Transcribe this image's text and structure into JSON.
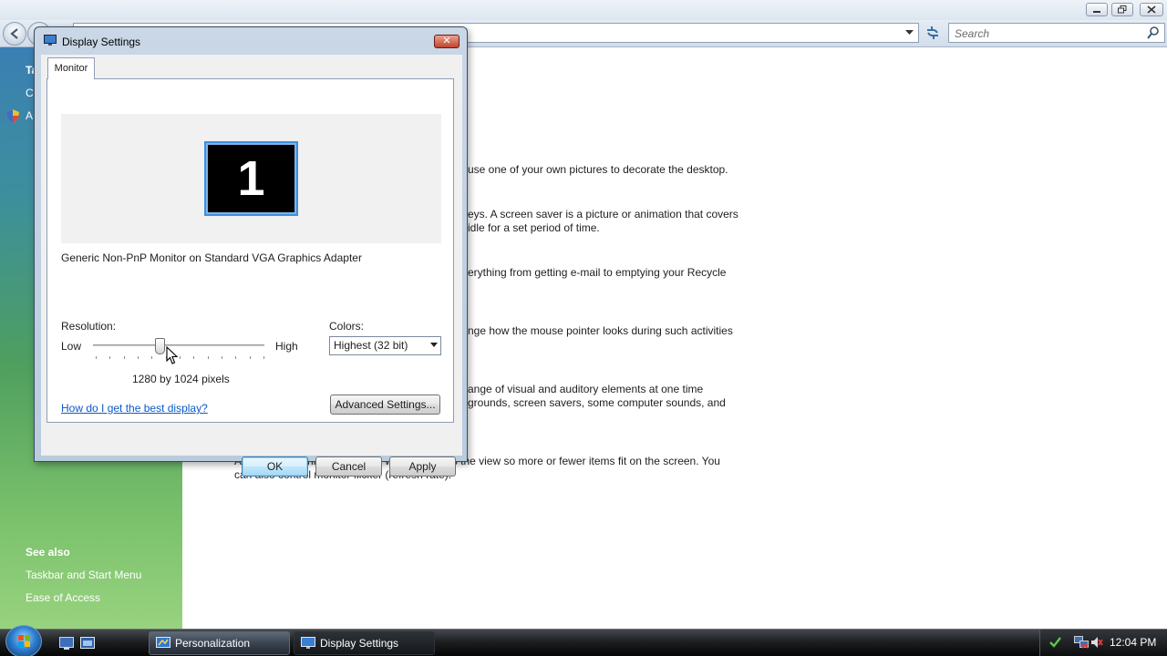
{
  "background_window": {
    "search": {
      "placeholder": "Search"
    },
    "left_pane": {
      "task_letters": [
        "Ta",
        "C",
        "A"
      ],
      "see_also_header": "See also",
      "see_also_links": [
        "Taskbar and Start Menu",
        "Ease of Access"
      ]
    },
    "content_lines": [
      "use one of your own pictures to decorate the desktop.",
      "eys. A screen saver is a picture or animation that covers",
      "idle for a set period of time.",
      "erything from getting e-mail to emptying your Recycle",
      "nge how the mouse pointer looks during such activities",
      "ange of visual and auditory elements at one time",
      "grounds, screen savers, some computer sounds, and",
      "Adjust your monitor resolution, which changes the view so more or fewer items fit on the screen. You",
      "can also control monitor flicker (refresh rate)."
    ]
  },
  "dialog": {
    "title": "Display Settings",
    "close_glyph": "✕",
    "tab_label": "Monitor",
    "monitor_number": "1",
    "monitor_name": "Generic Non-PnP Monitor on Standard VGA Graphics Adapter",
    "resolution_label": "Resolution:",
    "low_label": "Low",
    "high_label": "High",
    "resolution_level": 0.38,
    "resolution_value": "1280 by 1024 pixels",
    "colors_label": "Colors:",
    "colors_selected": "Highest (32 bit)",
    "help_link": "How do I get the best display?",
    "advanced_button": "Advanced Settings...",
    "ok_button": "OK",
    "cancel_button": "Cancel",
    "apply_button": "Apply"
  },
  "taskbar": {
    "tasks": [
      "Personalization",
      "Display Settings"
    ],
    "clock": "12:04 PM"
  },
  "colors": {
    "accent": "#3d8ee0",
    "link": "#0a59c6",
    "monitor_bg": "#000000"
  }
}
